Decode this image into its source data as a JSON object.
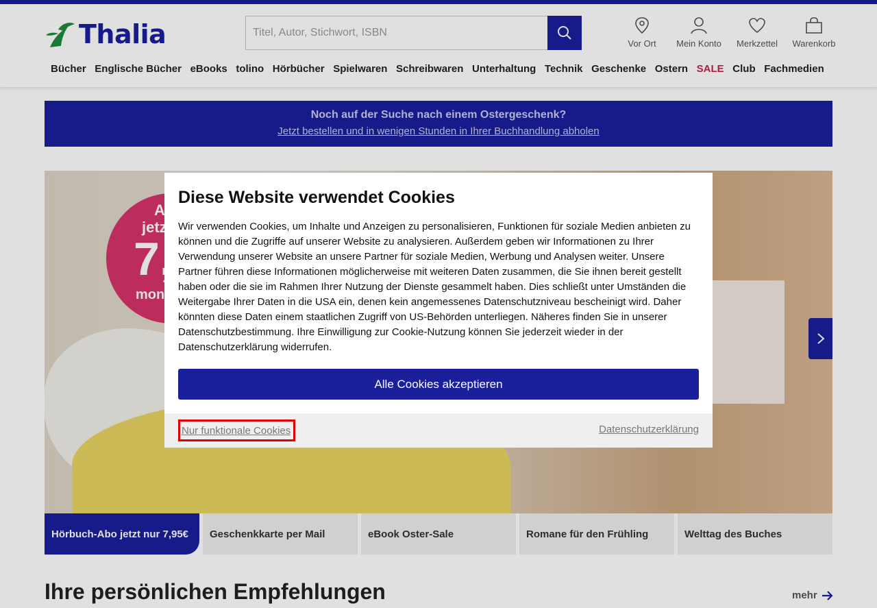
{
  "header": {
    "logo_text": "Thalia",
    "search_placeholder": "Titel, Autor, Stichwort, ISBN",
    "links": [
      {
        "label": "Vor Ort",
        "icon": "location-pin-icon"
      },
      {
        "label": "Mein Konto",
        "icon": "user-icon"
      },
      {
        "label": "Merkzettel",
        "icon": "heart-icon"
      },
      {
        "label": "Warenkorb",
        "icon": "shopping-bag-icon"
      }
    ],
    "nav": [
      "Bücher",
      "Englische Bücher",
      "eBooks",
      "tolino",
      "Hörbücher",
      "Spielwaren",
      "Schreibwaren",
      "Unterhaltung",
      "Technik",
      "Geschenke",
      "Ostern",
      "SALE",
      "Club",
      "Fachmedien"
    ]
  },
  "promo": {
    "title": "Noch auf der Suche nach einem Ostergeschenk?",
    "link": "Jetzt bestellen und in wenigen Stunden in Ihrer Buchhandlung abholen"
  },
  "hero": {
    "badge_line1": "A",
    "badge_line2": "jetz",
    "badge_price": "7,",
    "badge_line4": "mon"
  },
  "tabs": [
    "Hörbuch-Abo jetzt nur 7,95€",
    "Geschenkkarte per Mail",
    "eBook Oster-Sale",
    "Romane für den Frühling",
    "Welttag des Buches"
  ],
  "recommendations": {
    "title": "Ihre persönlichen Empfehlungen",
    "more": "mehr"
  },
  "cookie_modal": {
    "title": "Diese Website verwendet Cookies",
    "text": "Wir verwenden Cookies, um Inhalte und Anzeigen zu personalisieren, Funktionen für soziale Medien anbieten zu können und die Zugriffe auf unserer Website zu analysieren. Außerdem geben wir Informationen zu Ihrer Verwendung unserer Website an unsere Partner für soziale Medien, Werbung und Analysen weiter. Unsere Partner führen diese Informationen möglicherweise mit weiteren Daten zusammen, die Sie ihnen bereit gestellt haben oder die sie im Rahmen Ihrer Nutzung der Dienste gesammelt haben. Dies schließt unter Umständen die Weitergabe Ihrer Daten in die USA ein, denen kein angemessenes Datenschutzniveau bescheinigt wird. Daher könnten diese Daten einem staatlichen Zugriff von US-Behörden unterliegen. Näheres finden Sie in unserer Datenschutzbestimmung. Ihre Einwilligung zur Cookie-Nutzung können Sie jederzeit wieder in der Datenschutzerklärung widerrufen.",
    "accept_label": "Alle Cookies akzeptieren",
    "functional_label": "Nur funktionale Cookies",
    "privacy_label": "Datenschutzerklärung"
  },
  "colors": {
    "brand": "#1a1f9c",
    "logo_green": "#1e8a3a",
    "sale": "#c8214f",
    "highlight": "#e00000"
  }
}
